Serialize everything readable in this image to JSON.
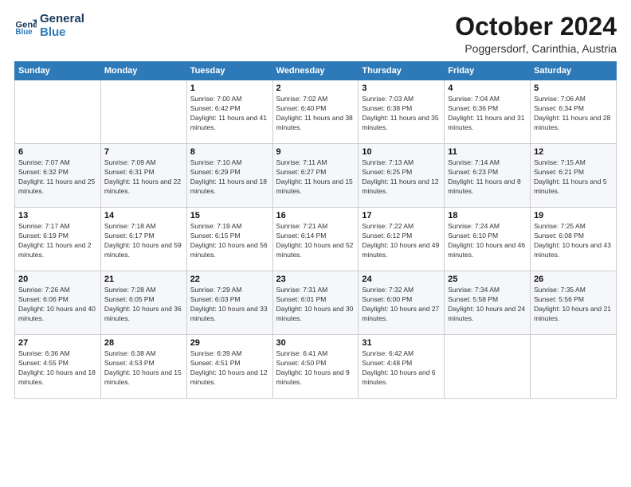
{
  "logo": {
    "line1": "General",
    "line2": "Blue"
  },
  "title": "October 2024",
  "subtitle": "Poggersdorf, Carinthia, Austria",
  "days_header": [
    "Sunday",
    "Monday",
    "Tuesday",
    "Wednesday",
    "Thursday",
    "Friday",
    "Saturday"
  ],
  "weeks": [
    [
      null,
      null,
      {
        "day": "1",
        "sunrise": "7:00 AM",
        "sunset": "6:42 PM",
        "daylight": "11 hours and 41 minutes."
      },
      {
        "day": "2",
        "sunrise": "7:02 AM",
        "sunset": "6:40 PM",
        "daylight": "11 hours and 38 minutes."
      },
      {
        "day": "3",
        "sunrise": "7:03 AM",
        "sunset": "6:38 PM",
        "daylight": "11 hours and 35 minutes."
      },
      {
        "day": "4",
        "sunrise": "7:04 AM",
        "sunset": "6:36 PM",
        "daylight": "11 hours and 31 minutes."
      },
      {
        "day": "5",
        "sunrise": "7:06 AM",
        "sunset": "6:34 PM",
        "daylight": "11 hours and 28 minutes."
      }
    ],
    [
      {
        "day": "6",
        "sunrise": "7:07 AM",
        "sunset": "6:32 PM",
        "daylight": "11 hours and 25 minutes."
      },
      {
        "day": "7",
        "sunrise": "7:09 AM",
        "sunset": "6:31 PM",
        "daylight": "11 hours and 22 minutes."
      },
      {
        "day": "8",
        "sunrise": "7:10 AM",
        "sunset": "6:29 PM",
        "daylight": "11 hours and 18 minutes."
      },
      {
        "day": "9",
        "sunrise": "7:11 AM",
        "sunset": "6:27 PM",
        "daylight": "11 hours and 15 minutes."
      },
      {
        "day": "10",
        "sunrise": "7:13 AM",
        "sunset": "6:25 PM",
        "daylight": "11 hours and 12 minutes."
      },
      {
        "day": "11",
        "sunrise": "7:14 AM",
        "sunset": "6:23 PM",
        "daylight": "11 hours and 8 minutes."
      },
      {
        "day": "12",
        "sunrise": "7:15 AM",
        "sunset": "6:21 PM",
        "daylight": "11 hours and 5 minutes."
      }
    ],
    [
      {
        "day": "13",
        "sunrise": "7:17 AM",
        "sunset": "6:19 PM",
        "daylight": "11 hours and 2 minutes."
      },
      {
        "day": "14",
        "sunrise": "7:18 AM",
        "sunset": "6:17 PM",
        "daylight": "10 hours and 59 minutes."
      },
      {
        "day": "15",
        "sunrise": "7:19 AM",
        "sunset": "6:15 PM",
        "daylight": "10 hours and 56 minutes."
      },
      {
        "day": "16",
        "sunrise": "7:21 AM",
        "sunset": "6:14 PM",
        "daylight": "10 hours and 52 minutes."
      },
      {
        "day": "17",
        "sunrise": "7:22 AM",
        "sunset": "6:12 PM",
        "daylight": "10 hours and 49 minutes."
      },
      {
        "day": "18",
        "sunrise": "7:24 AM",
        "sunset": "6:10 PM",
        "daylight": "10 hours and 46 minutes."
      },
      {
        "day": "19",
        "sunrise": "7:25 AM",
        "sunset": "6:08 PM",
        "daylight": "10 hours and 43 minutes."
      }
    ],
    [
      {
        "day": "20",
        "sunrise": "7:26 AM",
        "sunset": "6:06 PM",
        "daylight": "10 hours and 40 minutes."
      },
      {
        "day": "21",
        "sunrise": "7:28 AM",
        "sunset": "6:05 PM",
        "daylight": "10 hours and 36 minutes."
      },
      {
        "day": "22",
        "sunrise": "7:29 AM",
        "sunset": "6:03 PM",
        "daylight": "10 hours and 33 minutes."
      },
      {
        "day": "23",
        "sunrise": "7:31 AM",
        "sunset": "6:01 PM",
        "daylight": "10 hours and 30 minutes."
      },
      {
        "day": "24",
        "sunrise": "7:32 AM",
        "sunset": "6:00 PM",
        "daylight": "10 hours and 27 minutes."
      },
      {
        "day": "25",
        "sunrise": "7:34 AM",
        "sunset": "5:58 PM",
        "daylight": "10 hours and 24 minutes."
      },
      {
        "day": "26",
        "sunrise": "7:35 AM",
        "sunset": "5:56 PM",
        "daylight": "10 hours and 21 minutes."
      }
    ],
    [
      {
        "day": "27",
        "sunrise": "6:36 AM",
        "sunset": "4:55 PM",
        "daylight": "10 hours and 18 minutes."
      },
      {
        "day": "28",
        "sunrise": "6:38 AM",
        "sunset": "4:53 PM",
        "daylight": "10 hours and 15 minutes."
      },
      {
        "day": "29",
        "sunrise": "6:39 AM",
        "sunset": "4:51 PM",
        "daylight": "10 hours and 12 minutes."
      },
      {
        "day": "30",
        "sunrise": "6:41 AM",
        "sunset": "4:50 PM",
        "daylight": "10 hours and 9 minutes."
      },
      {
        "day": "31",
        "sunrise": "6:42 AM",
        "sunset": "4:48 PM",
        "daylight": "10 hours and 6 minutes."
      },
      null,
      null
    ]
  ]
}
